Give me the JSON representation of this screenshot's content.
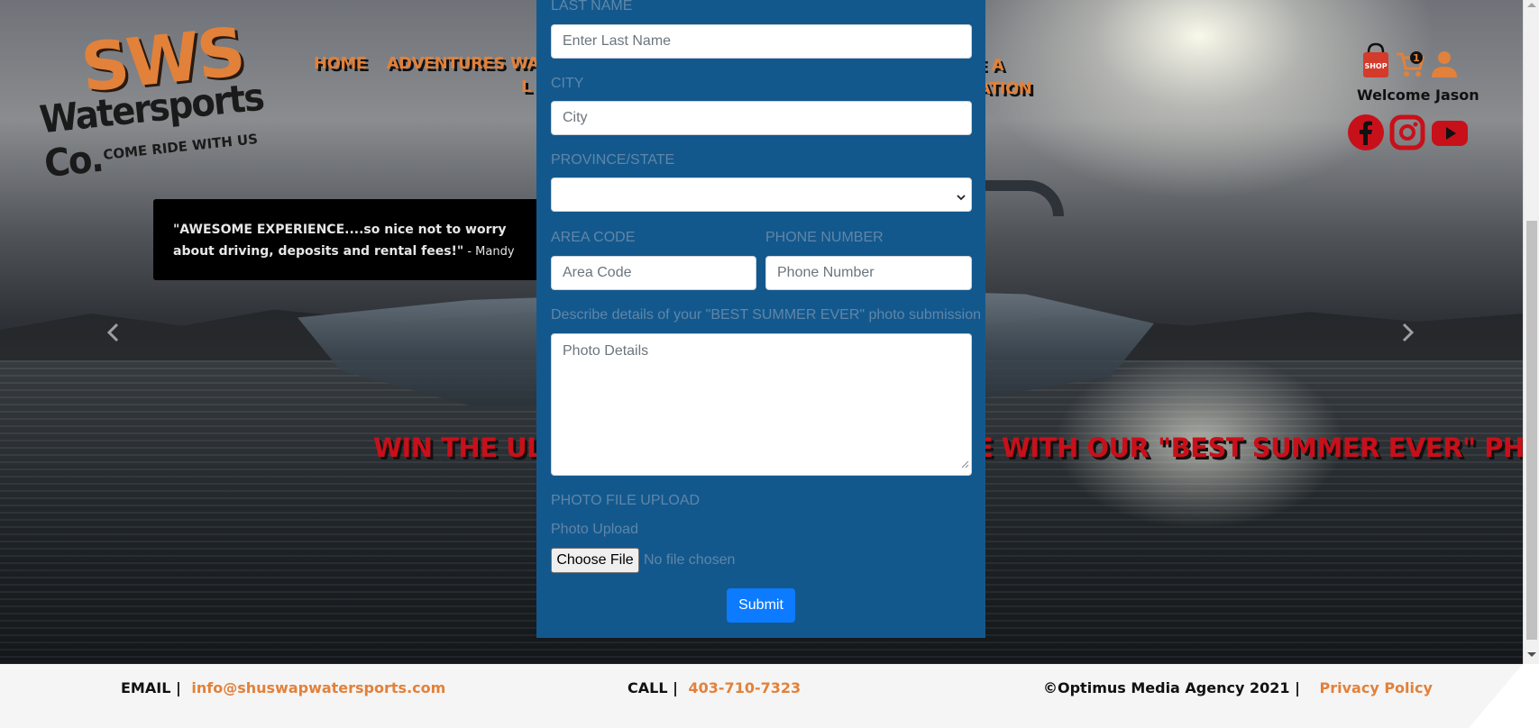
{
  "logo": {
    "line1": "SWS",
    "line2": "Watersports Co.",
    "tagline": "COME RIDE WITH US"
  },
  "nav": {
    "items": [
      "HOME",
      "ADVENTURES"
    ],
    "partial_1_top": "WA",
    "partial_1_bottom": "L",
    "partial_2_top": "E A",
    "partial_2_bottom": "ATION"
  },
  "header_right": {
    "cart_count": "1",
    "shop_label": "SHOP",
    "welcome": "Welcome Jason"
  },
  "testimonial": {
    "quote": "\"AWESOME EXPERIENCE....so nice not to worry about driving, deposits and rental fees!\"",
    "author": " - Mandy"
  },
  "marquee": {
    "left": "WIN THE ULT",
    "right": "E WITH OUR \"BEST SUMMER EVER\" PHO"
  },
  "form": {
    "last_name_label": "LAST NAME",
    "last_name_placeholder": "Enter Last Name",
    "city_label": "CITY",
    "city_placeholder": "City",
    "province_label": "PROVINCE/STATE",
    "province_value": "",
    "area_code_label": "AREA CODE",
    "area_code_placeholder": "Area Code",
    "phone_label": "PHONE NUMBER",
    "phone_placeholder": "Phone Number",
    "details_label": "Describe details of your \"BEST SUMMER EVER\" photo submission",
    "details_placeholder": "Photo Details",
    "upload_label": "PHOTO FILE UPLOAD",
    "upload_sub_label": "Photo Upload",
    "choose_file": "Choose File",
    "no_file": "No file chosen",
    "submit": "Submit"
  },
  "footer": {
    "email_label": "EMAIL |",
    "email": "info@shuswapwatersports.com",
    "call_label": "CALL |",
    "phone": "403-710-7323",
    "copyright": "©Optimus Media Agency 2021 |",
    "privacy": "Privacy Policy"
  },
  "colors": {
    "brand_orange": "#e2813a",
    "form_blue": "#13588d",
    "submit_blue": "#0d7bff",
    "marquee_red": "#c8101a"
  }
}
